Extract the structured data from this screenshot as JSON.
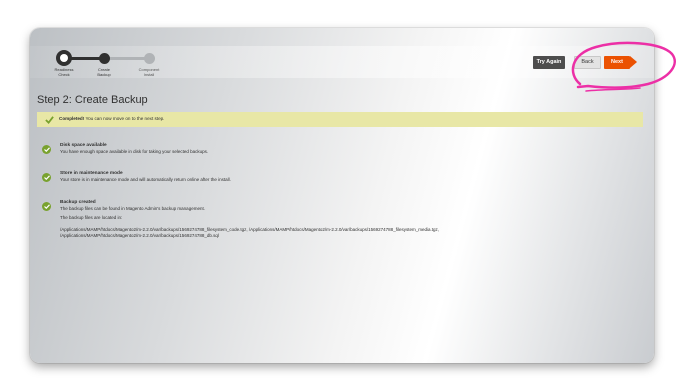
{
  "wizard": {
    "steps": [
      {
        "label_line1": "Readiness",
        "label_line2": "Check",
        "state": "current"
      },
      {
        "label_line1": "Create",
        "label_line2": "Backup",
        "state": "done"
      },
      {
        "label_line1": "Component",
        "label_line2": "Install",
        "state": "todo"
      }
    ],
    "buttons": {
      "try_again": "Try Again",
      "back": "Back",
      "next": "Next"
    }
  },
  "page": {
    "title": "Step 2: Create Backup"
  },
  "success": {
    "strong": "Completed!",
    "text": " You can now move on to the next step."
  },
  "items": [
    {
      "title": "Disk space available",
      "lines": [
        "You have enough space available in disk for taking your selected backups."
      ]
    },
    {
      "title": "Store in maintenance mode",
      "lines": [
        "Your store is in maintenance mode and will automatically return online after the install."
      ]
    },
    {
      "title": "Backup created",
      "lines": [
        "The backup files can be found in Magento Admin's backup management.",
        "The backup files are located in:",
        "/Applications/MAMP/htdocs/Magento2/m-2.2.0/var/backups/1569274788_filesystem_code.tgz, /Applications/MAMP/htdocs/Magento2/m-2.2.0/var/backups/1569274788_filesystem_media.tgz,",
        "/Applications/MAMP/htdocs/Magento2/m-2.2.0/var/backups/1569274788_db.sql"
      ]
    }
  ],
  "colors": {
    "accent": "#eb5202",
    "success": "#79a22e",
    "success_bg": "#e8e7a6",
    "annotation": "#ec2fa6"
  }
}
